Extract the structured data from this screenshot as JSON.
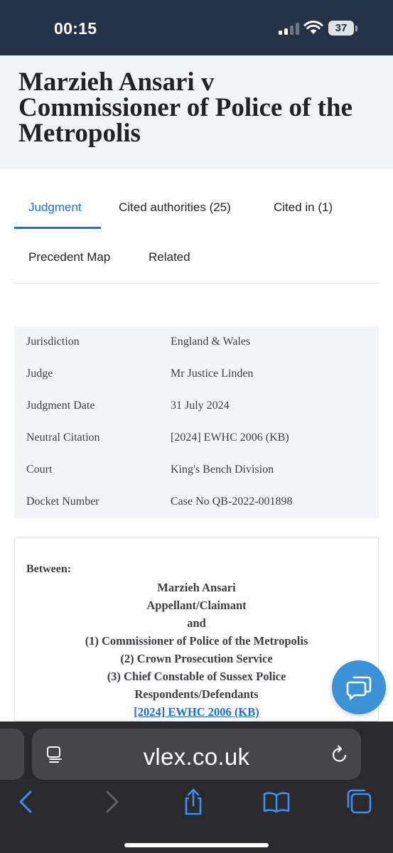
{
  "status_bar": {
    "time": "00:15",
    "battery_level": "37",
    "signal_icon": "cellular-signal-icon",
    "wifi_icon": "wifi-icon"
  },
  "page": {
    "title": "Marzieh Ansari v Commissioner of Police of the Metropolis"
  },
  "tabs": [
    {
      "label": "Judgment",
      "active": true
    },
    {
      "label": "Cited authorities (25)",
      "active": false
    },
    {
      "label": "Cited in (1)",
      "active": false
    },
    {
      "label": "Precedent Map",
      "active": false
    },
    {
      "label": "Related",
      "active": false
    }
  ],
  "metadata": [
    {
      "key": "Jurisdiction",
      "value": "England & Wales"
    },
    {
      "key": "Judge",
      "value": "Mr Justice Linden"
    },
    {
      "key": "Judgment Date",
      "value": "31 July 2024"
    },
    {
      "key": "Neutral Citation",
      "value": "[2024] EWHC 2006 (KB)"
    },
    {
      "key": "Court",
      "value": "King's Bench Division"
    },
    {
      "key": "Docket Number",
      "value": "Case No QB-2022-001898"
    }
  ],
  "judgment": {
    "between_label": "Between:",
    "lines": [
      "Marzieh Ansari",
      "Appellant/Claimant",
      "and",
      "(1) Commissioner of Police of the Metropolis",
      "(2) Crown Prosecution Service",
      "(3) Chief Constable of Sussex Police",
      "Respondents/Defendants"
    ],
    "citation_link": "[2024] EWHC 2006 (KB)"
  },
  "chat_button": {
    "icon": "chat-bubbles-icon"
  },
  "browser": {
    "url": "vlex.co.uk",
    "reader_icon": "reader-mode-icon",
    "reload_icon": "reload-icon",
    "toolbar_icons": [
      "back-icon",
      "forward-icon",
      "share-icon",
      "bookmarks-icon",
      "tabs-icon"
    ]
  },
  "colors": {
    "status_bar_bg": "#253349",
    "accent_blue": "#1b6fd8",
    "fab_blue": "#3b93d6",
    "browser_bg": "#2a2a2d"
  }
}
